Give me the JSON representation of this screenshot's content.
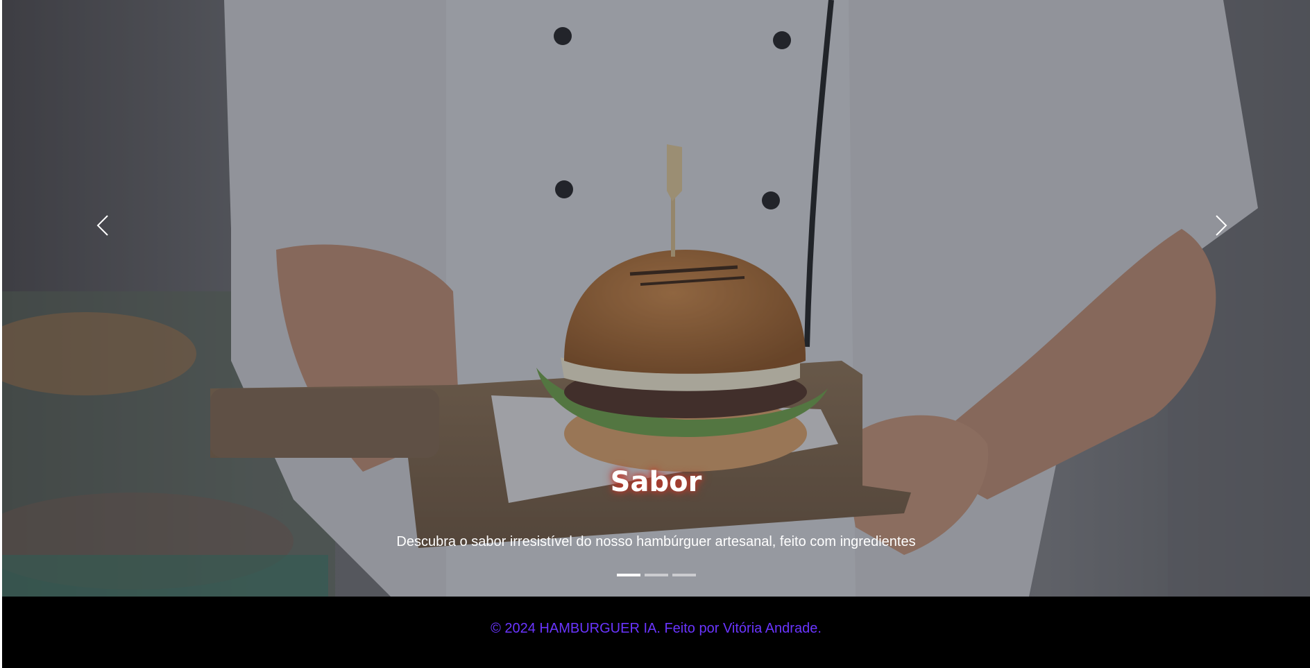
{
  "carousel": {
    "slide": {
      "title": "Sabor",
      "text": "Descubra o sabor irresistível do nosso hambúrguer artesanal, feito com ingredientes",
      "image": "chef-holding-burger-on-wooden-board"
    },
    "indicators": [
      {
        "active": true
      },
      {
        "active": false
      },
      {
        "active": false
      }
    ],
    "prev_icon": "chevron-left-icon",
    "next_icon": "chevron-right-icon"
  },
  "footer": {
    "text": "© 2024 HAMBURGUER IA. Feito por Vitória Andrade.",
    "color": "#6a35ff"
  }
}
